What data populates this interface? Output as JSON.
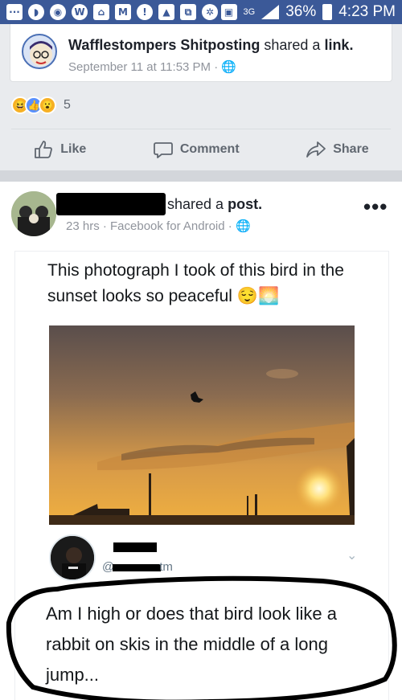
{
  "status_bar": {
    "battery": "36%",
    "time": "4:23 PM",
    "network": "3G"
  },
  "shared_link_card": {
    "page_name": "Wafflestompers Shitposting",
    "action_text": "shared a",
    "object": "link.",
    "timestamp": "September 11 at 11:53 PM"
  },
  "reactions": {
    "count": "5"
  },
  "actions": {
    "like": "Like",
    "comment": "Comment",
    "share": "Share"
  },
  "post": {
    "action_text": "shared a",
    "object": "post.",
    "meta": "23 hrs · Facebook for Android ·",
    "more": "•••"
  },
  "tweet": {
    "text": "This photograph I took of this bird in the sunset looks so peaceful 😌🌅",
    "reply_handle_prefix": "@",
    "reply_handle_suffix": "tm",
    "reply_text": "Am I high or does that bird look like a rabbit on skis in the middle of a long jump..."
  },
  "colors": {
    "facebook_blue": "#3b5998",
    "meta_gray": "#90949c",
    "sunset_orange": "#e8962e"
  }
}
